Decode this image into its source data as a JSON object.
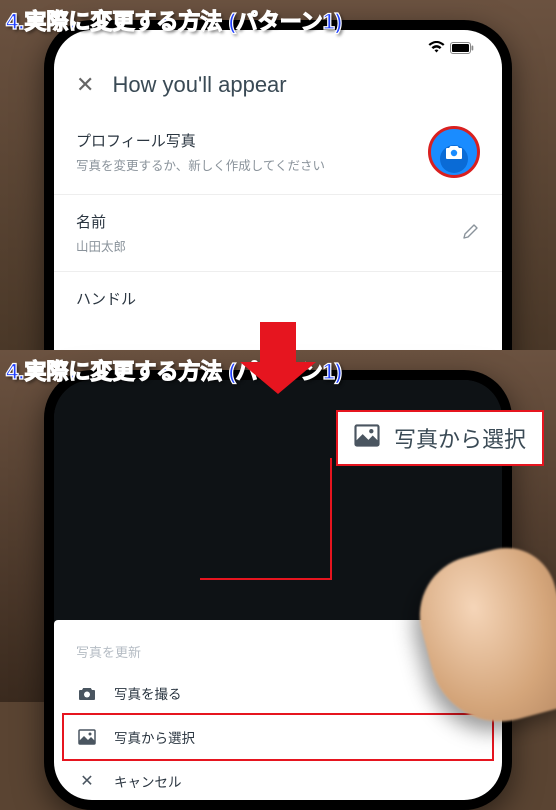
{
  "sectionTitle": "4.実際に変更する方法 (パターン1)",
  "status": {
    "time": "",
    "wifi": "wifi-icon",
    "battery": "battery-icon"
  },
  "header": {
    "close": "✕",
    "title": "How you'll appear"
  },
  "rows": {
    "profilePhoto": {
      "title": "プロフィール写真",
      "sub": "写真を変更するか、新しく作成してください"
    },
    "name": {
      "title": "名前",
      "sub": "山田太郎"
    },
    "handle": {
      "title": "ハンドル"
    }
  },
  "sheet": {
    "label": "写真を更新",
    "takePhoto": "写真を撮る",
    "choosePhoto": "写真から選択",
    "cancel": "キャンセル"
  },
  "callout": {
    "text": "写真から選択"
  }
}
